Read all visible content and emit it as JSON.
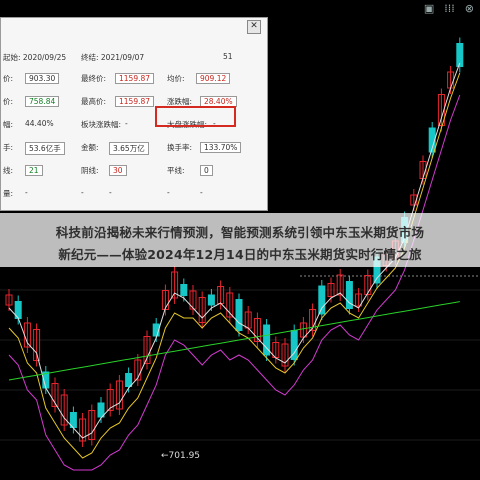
{
  "window_controls": {
    "pin": "▣",
    "menu": "⁞⁞⁞",
    "close": "⊗"
  },
  "stats": {
    "start_label": "起始: 2020/09/25",
    "end_label": "终结: 2021/09/07",
    "period_count": "51",
    "open_label": "价:",
    "open_value": "903.30",
    "close_label": "最终价:",
    "close_value": "1159.87",
    "avg_label": "均价:",
    "avg_value": "909.12",
    "low_label": "价:",
    "low_value": "758.84",
    "high_label": "最高价:",
    "high_value": "1159.87",
    "change_pct_label": "涨跌幅:",
    "change_pct_value": "28.40%",
    "amp_label": "幅:",
    "amp_value": "44.40%",
    "sector_label": "板块涨跌幅:",
    "sector_value": "-",
    "index_label": "大盘涨跌幅:",
    "index_value": "-",
    "hand_label": "手:",
    "hand_value": "53.6亿手",
    "amount_label": "金额:",
    "amount_value": "3.65万亿",
    "turnover_label": "换手率:",
    "turnover_value": "133.70%",
    "up_label": "线:",
    "up_value": "21",
    "down_label": "阴线:",
    "down_value": "30",
    "flat_label": "平线:",
    "flat_value": "0",
    "vol_label": "量:",
    "vol_value": "-",
    "mid_label": "-",
    "mid_value": "-",
    "right_label": "-",
    "right_value": "-"
  },
  "banner": {
    "line1": "科技前沿揭秘未来行情预测，智能预测系统引领中东玉米期货市场",
    "line2": "新纪元——体验2024年12月14日的中东玉米期货实时行情之旅"
  },
  "low_price_label": "←701.95",
  "colors": {
    "up": "#e8262e",
    "down": "#17c7c7",
    "ma1": "#e0e0e0",
    "ma2": "#e6c62a",
    "ma3": "#d23ad0",
    "ma4": "#2ad12a",
    "highlight": "#d42a21"
  }
}
